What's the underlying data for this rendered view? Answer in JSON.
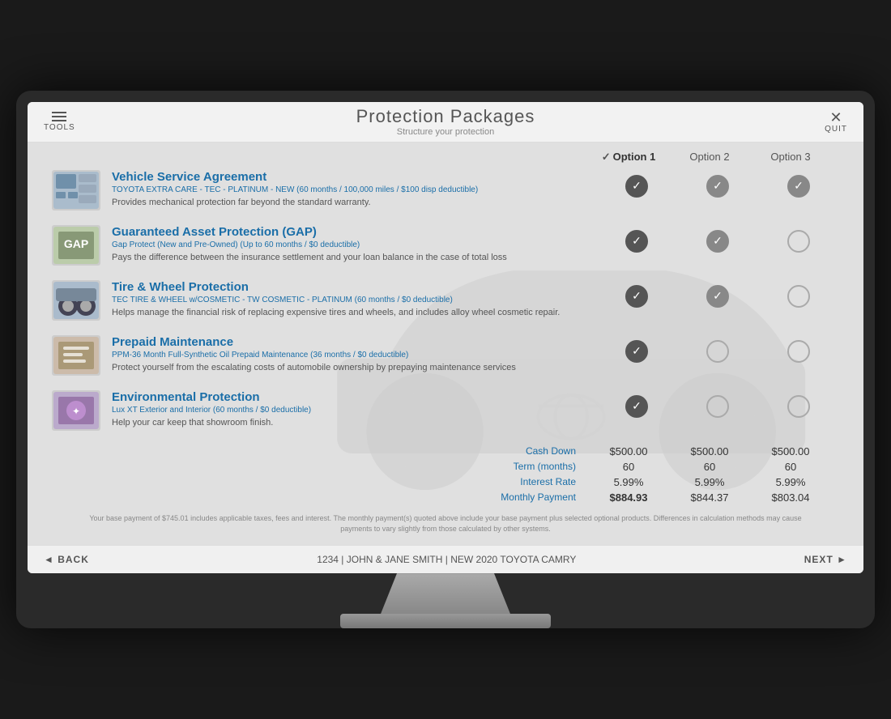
{
  "header": {
    "tools_label": "TOOLS",
    "title": "Protection Packages",
    "subtitle": "Structure your protection",
    "quit_label": "QUIT"
  },
  "options": [
    {
      "label": "Option 1",
      "selected": true
    },
    {
      "label": "Option 2",
      "selected": false
    },
    {
      "label": "Option 3",
      "selected": false
    }
  ],
  "products": [
    {
      "name": "Vehicle Service Agreement",
      "subtitle": "TOYOTA EXTRA CARE - TEC - PLATINUM - NEW (60 months / 100,000 miles / $100 disp deductible)",
      "desc": "Provides mechanical protection far beyond the standard warranty.",
      "checks": [
        "dark",
        "light",
        "light"
      ]
    },
    {
      "name": "Guaranteed Asset Protection (GAP)",
      "subtitle": "Gap Protect (New and Pre-Owned) (Up to 60 months / $0 deductible)",
      "desc": "Pays the difference between the insurance settlement and your loan balance in the case of total loss",
      "checks": [
        "dark",
        "light",
        "none"
      ]
    },
    {
      "name": "Tire & Wheel Protection",
      "subtitle": "TEC TIRE & WHEEL w/COSMETIC - TW COSMETIC - PLATINUM (60 months / $0 deductible)",
      "desc": "Helps manage the financial risk of replacing expensive tires and wheels, and includes alloy wheel cosmetic repair.",
      "checks": [
        "dark",
        "light",
        "none"
      ]
    },
    {
      "name": "Prepaid Maintenance",
      "subtitle": "PPM-36 Month Full-Synthetic Oil Prepaid Maintenance (36 months / $0 deductible)",
      "desc": "Protect yourself from the escalating costs of automobile ownership by prepaying maintenance services",
      "checks": [
        "dark",
        "none",
        "none"
      ]
    },
    {
      "name": "Environmental Protection",
      "subtitle": "Lux XT Exterior and Interior (60 months / $0 deductible)",
      "desc": "Help your car keep that showroom finish.",
      "checks": [
        "dark",
        "none",
        "none"
      ]
    }
  ],
  "summary": {
    "rows": [
      {
        "label": "Cash Down",
        "vals": [
          "$500.00",
          "$500.00",
          "$500.00"
        ],
        "bold": false
      },
      {
        "label": "Term (months)",
        "vals": [
          "60",
          "60",
          "60"
        ],
        "bold": false
      },
      {
        "label": "Interest Rate",
        "vals": [
          "5.99%",
          "5.99%",
          "5.99%"
        ],
        "bold": false
      },
      {
        "label": "Monthly Payment",
        "vals": [
          "$884.93",
          "$844.37",
          "$803.04"
        ],
        "bold": true
      }
    ]
  },
  "disclaimer": "Your base payment of $745.01 includes applicable taxes, fees and interest. The monthly payment(s) quoted above include your base payment plus selected optional products. Differences in calculation methods may cause payments to vary slightly from those calculated by other systems.",
  "footer": {
    "back_label": "◄ BACK",
    "info": "1234 | JOHN & JANE SMITH | NEW 2020 TOYOTA CAMRY",
    "next_label": "NEXT ►"
  }
}
